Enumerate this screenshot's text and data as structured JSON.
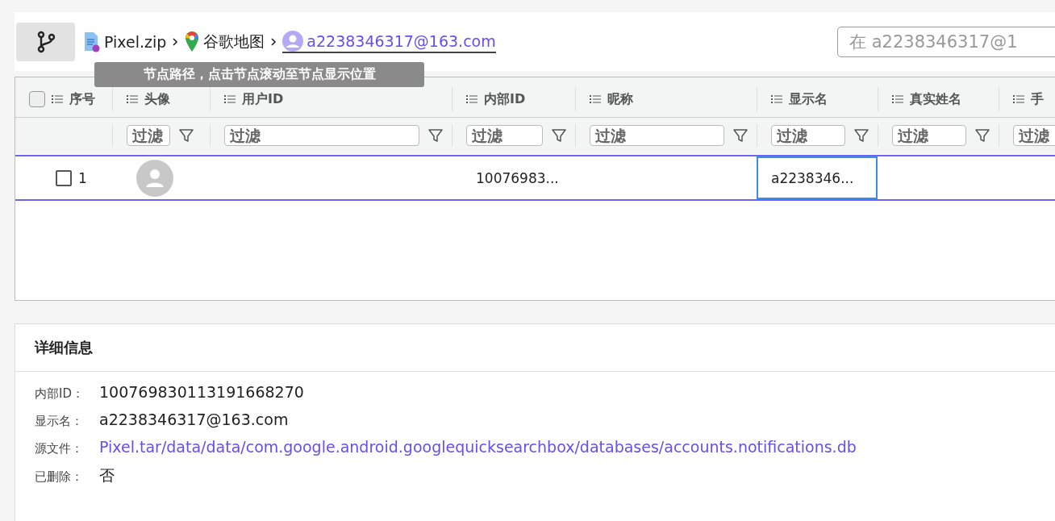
{
  "breadcrumb": [
    {
      "kind": "zip",
      "label": "Pixel.zip"
    },
    {
      "kind": "maps",
      "label": "谷歌地图"
    },
    {
      "kind": "account",
      "label": "a2238346317@163.com"
    }
  ],
  "tooltip": "节点路径，点击节点滚动至节点显示位置",
  "search": {
    "placeholder": "在 a2238346317@1"
  },
  "table": {
    "all_checked": false,
    "columns": [
      {
        "label": "序号"
      },
      {
        "label": "头像",
        "placeholder": "过滤"
      },
      {
        "label": "用户ID",
        "placeholder": "过滤"
      },
      {
        "label": "内部ID",
        "placeholder": "过滤"
      },
      {
        "label": "昵称",
        "placeholder": "过滤"
      },
      {
        "label": "显示名",
        "placeholder": "过滤"
      },
      {
        "label": "真实姓名",
        "placeholder": "过滤"
      },
      {
        "label": "手",
        "placeholder": "过滤"
      }
    ],
    "rows": [
      {
        "selected": true,
        "checked": false,
        "cells": [
          {
            "kind": "index",
            "text": "1",
            "focused": false
          },
          {
            "kind": "avatar",
            "focused": false
          },
          {
            "kind": "text",
            "text": "",
            "focused": false
          },
          {
            "kind": "text",
            "text": "10076983...",
            "focused": false
          },
          {
            "kind": "text",
            "text": "",
            "focused": false
          },
          {
            "kind": "text",
            "text": "a2238346...",
            "focused": true
          },
          {
            "kind": "text",
            "text": "",
            "focused": false
          },
          {
            "kind": "text",
            "text": "",
            "focused": false
          }
        ]
      }
    ]
  },
  "details": {
    "title": "详细信息",
    "fields": [
      {
        "label": "内部ID：",
        "value": "100769830113191668270",
        "kind": "text"
      },
      {
        "label": "显示名：",
        "value": "a2238346317@163.com",
        "kind": "text"
      },
      {
        "label": "源文件：",
        "value": "Pixel.tar/data/data/com.google.android.googlequicksearchbox/databases/accounts.notifications.db",
        "kind": "link"
      },
      {
        "label": "已删除：",
        "value": "否",
        "kind": "text"
      }
    ]
  }
}
